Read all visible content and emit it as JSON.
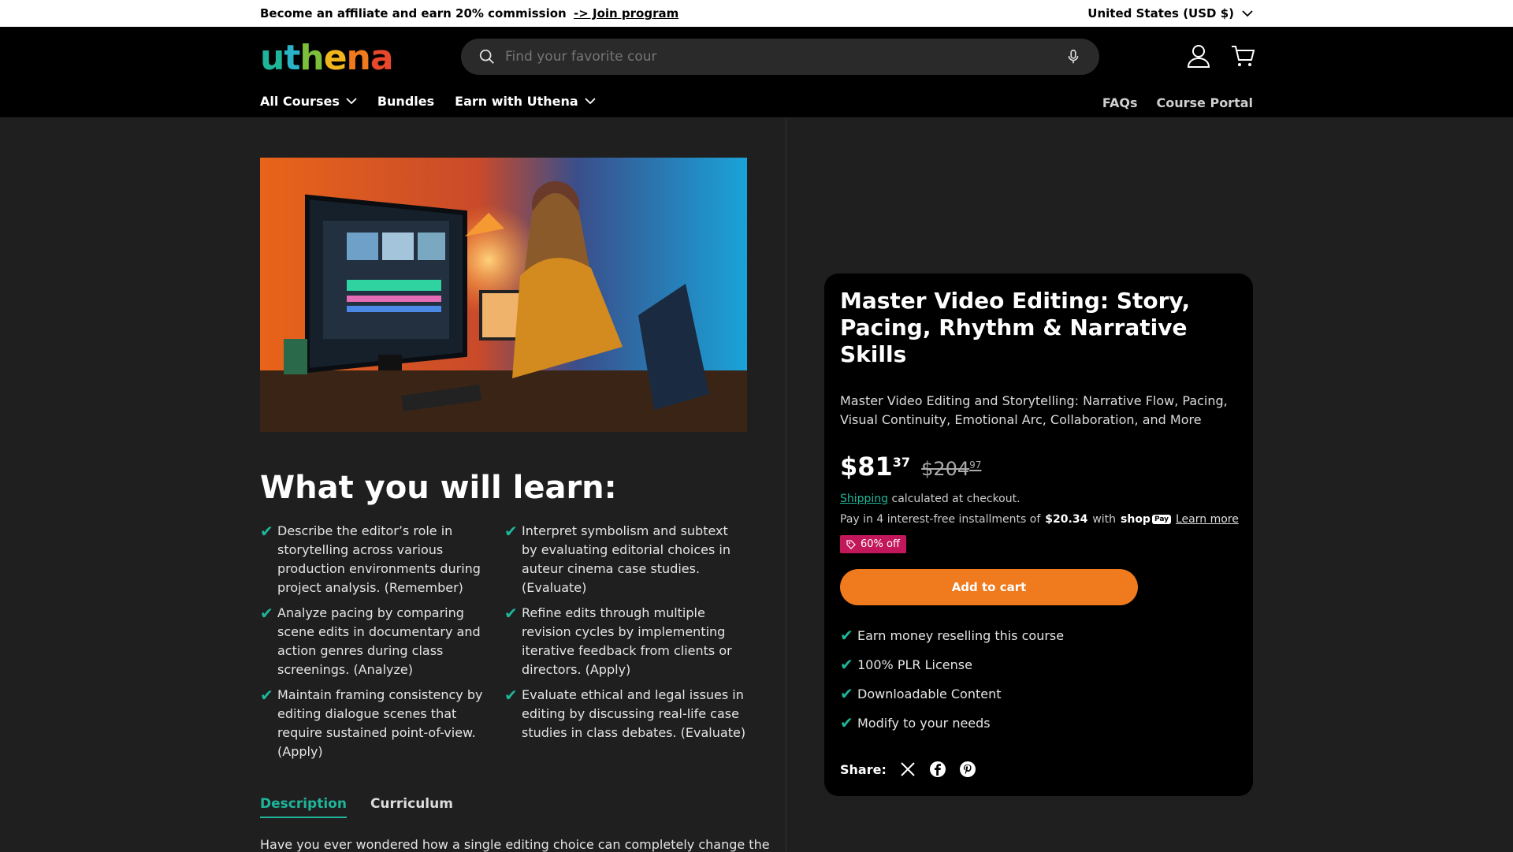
{
  "announcement": {
    "text": "Become an affiliate and earn 20% commission",
    "link": "-> Join program",
    "currency": "United States (USD $)"
  },
  "header": {
    "logo": [
      "u",
      "t",
      "h",
      "e",
      "n",
      "a"
    ],
    "logo_colors": [
      "#1fb59a",
      "#2ab3c6",
      "#7bbf3a",
      "#f2b61d",
      "#f07a1e",
      "#e8482c"
    ],
    "search_placeholder": "Find your favorite cour",
    "nav": [
      {
        "label": "All Courses",
        "dropdown": true
      },
      {
        "label": "Bundles",
        "dropdown": false
      },
      {
        "label": "Earn with Uthena",
        "dropdown": true
      }
    ],
    "nav_right": [
      "FAQs",
      "Course Portal"
    ]
  },
  "learn": {
    "title": "What you will learn:",
    "col1": [
      "Describe the editor’s role in storytelling across various production environments during project analysis. (Remember)",
      "Analyze pacing by comparing scene edits in documentary and action genres during class screenings. (Analyze)",
      "Maintain framing consistency by editing dialogue scenes that require sustained point-of-view. (Apply)"
    ],
    "col2": [
      "Interpret symbolism and subtext by evaluating editorial choices in auteur cinema case studies. (Evaluate)",
      "Refine edits through multiple revision cycles by implementing iterative feedback from clients or directors. (Apply)",
      "Evaluate ethical and legal issues in editing by discussing real-life case studies in class debates. (Evaluate)"
    ]
  },
  "tabs": [
    "Description",
    "Curriculum"
  ],
  "description_preview": "Have you ever wondered how a single editing choice can completely change the",
  "product": {
    "title": "Master Video Editing: Story, Pacing, Rhythm & Narrative Skills",
    "subtitle": "Master Video Editing and Storytelling: Narrative Flow, Pacing, Visual Continuity, Emotional Arc, Collaboration, and More",
    "price_main": "$81",
    "price_cents": "37",
    "compare_main": "$204",
    "compare_cents": "97",
    "shipping_link": "Shipping",
    "shipping_text": "calculated at checkout.",
    "installments_prefix": "Pay in 4 interest-free installments of",
    "installment_amount": "$20.34",
    "installments_with": "with",
    "shoppay_label": "shop",
    "shoppay_pay": "Pay",
    "learn_more": "Learn more",
    "badge": "60% off",
    "add_to_cart": "Add to cart",
    "features": [
      "Earn money reselling this course",
      "100% PLR License",
      "Downloadable Content",
      "Modify to your needs"
    ],
    "share_label": "Share:"
  },
  "colors": {
    "accent": "#1fb59a",
    "button": "#f07a1e",
    "badge": "#c2185b"
  }
}
